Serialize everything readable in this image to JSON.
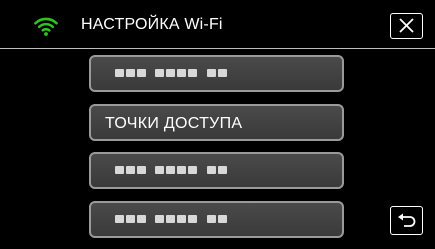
{
  "header": {
    "title": "НАСТРОЙКА Wi-Fi",
    "wifi_icon": "wifi-icon",
    "close_icon": "close-icon",
    "accent_color": "#2ec41f"
  },
  "menu": {
    "items": [
      {
        "label": "",
        "obscured": true
      },
      {
        "label": "ТОЧКИ ДОСТУПА",
        "obscured": false
      },
      {
        "label": "",
        "obscured": true
      },
      {
        "label": "",
        "obscured": true
      }
    ]
  },
  "footer": {
    "back_icon": "return-arrow-icon"
  }
}
